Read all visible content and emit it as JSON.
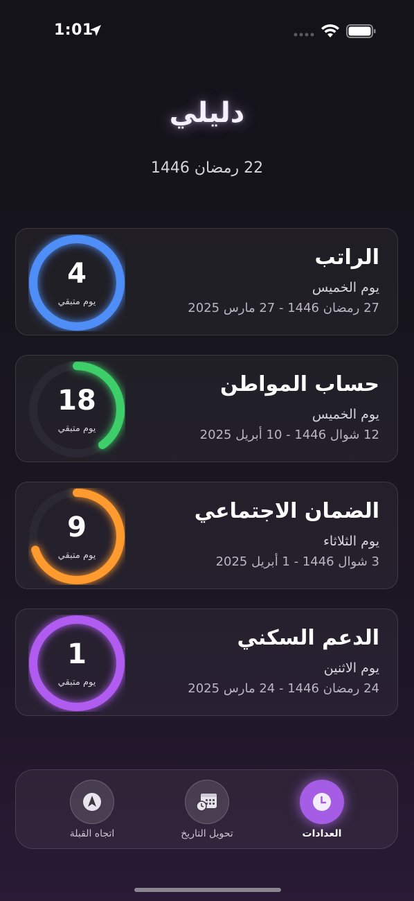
{
  "status": {
    "time": "1:01"
  },
  "header": {
    "title": "دليلي",
    "hijri_date": "22 رمضان 1446"
  },
  "counters": [
    {
      "name": "الراتب",
      "day": "يوم الخميس",
      "range": "27 رمضان 1446 - 27 مارس 2025",
      "days_left": "4",
      "label": "يوم متبقي",
      "color": "#4f8ef7",
      "progress": 1.0
    },
    {
      "name": "حساب المواطن",
      "day": "يوم الخميس",
      "range": "12 شوال 1446 - 10 أبريل 2025",
      "days_left": "18",
      "label": "يوم متبقي",
      "color": "#3ecf6a",
      "progress": 0.4
    },
    {
      "name": "الضمان الاجتماعي",
      "day": "يوم الثلاثاء",
      "range": "3 شوال 1446 - 1 أبريل 2025",
      "days_left": "9",
      "label": "يوم متبقي",
      "color": "#ff9a2e",
      "progress": 0.7
    },
    {
      "name": "الدعم السكني",
      "day": "يوم الاثنين",
      "range": "24 رمضان 1446 - 24 مارس 2025",
      "days_left": "1",
      "label": "يوم متبقي",
      "color": "#b05cf0",
      "progress": 1.0
    }
  ],
  "tabs": [
    {
      "label": "اتجاه القبلة",
      "icon": "compass-icon",
      "active": false
    },
    {
      "label": "تحويل التاريخ",
      "icon": "calendar-clock-icon",
      "active": false
    },
    {
      "label": "العدادات",
      "icon": "clock-icon",
      "active": true
    }
  ]
}
